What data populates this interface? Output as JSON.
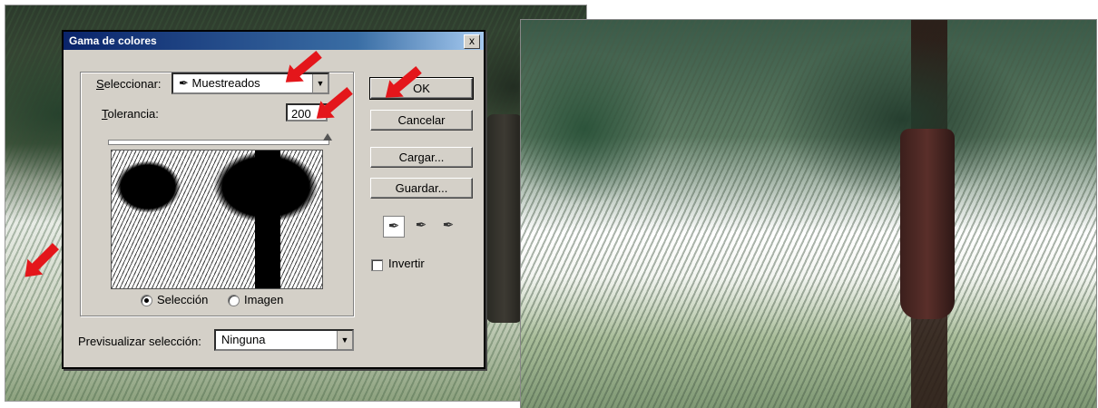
{
  "dialog": {
    "title": "Gama de colores",
    "close_glyph": "x",
    "select": {
      "label": "Seleccionar:",
      "value": "Muestreados",
      "icon": "eyedropper-icon"
    },
    "tolerance": {
      "label": "Tolerancia:",
      "value": "200",
      "slider_fraction": 0.99
    },
    "radio": {
      "selection_label": "Selección",
      "image_label": "Imagen",
      "selected": "Selección"
    },
    "preview_selection": {
      "label": "Previsualizar selección:",
      "value": "Ninguna"
    },
    "buttons": {
      "ok": "OK",
      "cancel": "Cancelar",
      "load": "Cargar...",
      "save": "Guardar..."
    },
    "tools": [
      "eyedropper-icon",
      "eyedropper-plus-icon",
      "eyedropper-minus-icon"
    ],
    "invert": {
      "label": "Invertir",
      "checked": false
    }
  },
  "annotation_color": "#e4161b"
}
